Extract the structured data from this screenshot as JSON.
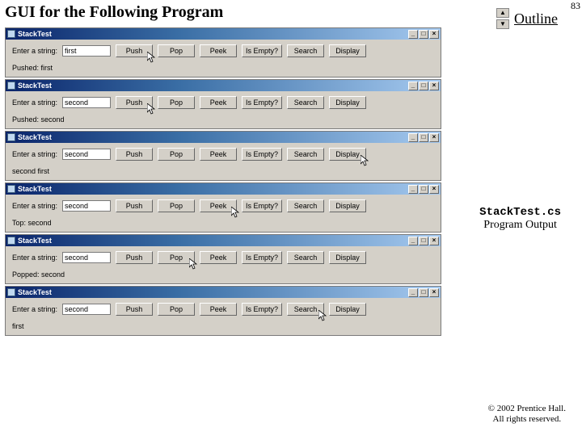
{
  "slide": {
    "title": "GUI for the Following Program",
    "page": "83",
    "outline_label": "Outline"
  },
  "windows_common": {
    "title": "StackTest",
    "input_label": "Enter a string:",
    "buttons": [
      "Push",
      "Pop",
      "Peek",
      "Is Empty?",
      "Search",
      "Display"
    ],
    "min": "_",
    "max": "□",
    "close": "×"
  },
  "windows": [
    {
      "input_value": "first",
      "status": "Pushed: first",
      "cursor_after_btn": 0
    },
    {
      "input_value": "second",
      "status": "Pushed: second",
      "cursor_after_btn": 0
    },
    {
      "input_value": "second",
      "status": "second first",
      "cursor_after_btn": 5
    },
    {
      "input_value": "second",
      "status": "Top: second",
      "cursor_after_btn": 2
    },
    {
      "input_value": "second",
      "status": "Popped: second",
      "cursor_after_btn": 1
    },
    {
      "input_value": "second",
      "status": "first",
      "cursor_after_btn": 4
    }
  ],
  "caption": {
    "code": "StackTest.cs",
    "sub": "Program Output"
  },
  "copyright": {
    "line1": "© 2002 Prentice Hall.",
    "line2": "All rights reserved."
  }
}
